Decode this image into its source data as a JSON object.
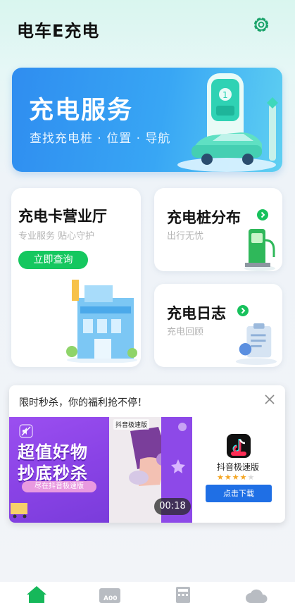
{
  "app": {
    "title": "电车E充电"
  },
  "header": {
    "settings_icon": "gear-icon"
  },
  "banner": {
    "title": "充电服务",
    "subtitle": "查找充电桩 · 位置 · 导航"
  },
  "cards": {
    "business_hall": {
      "title": "充电卡营业厅",
      "subtitle": "专业服务 贴心守护",
      "button": "立即查询"
    },
    "pile_map": {
      "title": "充电桩分布",
      "subtitle": "出行无忧"
    },
    "log": {
      "title": "充电日志",
      "subtitle": "充电回顾"
    }
  },
  "ad": {
    "headline": "限时秒杀，你的福利抢不停！",
    "banner_line1": "超值好物",
    "banner_line2": "抄底秒杀",
    "banner_pill": "尽在抖音极速版",
    "video_tag": "抖音极速版",
    "video_time": "00:18",
    "app_name": "抖音极速版",
    "rating": 4,
    "rating_max": 5,
    "download_label": "点击下载"
  },
  "tabbar": {
    "items": [
      {
        "icon": "home-icon",
        "active": true
      },
      {
        "icon": "ticket-icon",
        "active": false
      },
      {
        "icon": "calculator-icon",
        "active": false
      },
      {
        "icon": "cloud-icon",
        "active": false
      }
    ]
  },
  "colors": {
    "accent": "#15c75f",
    "banner": "#2f8df0",
    "download": "#1f6fe5"
  }
}
